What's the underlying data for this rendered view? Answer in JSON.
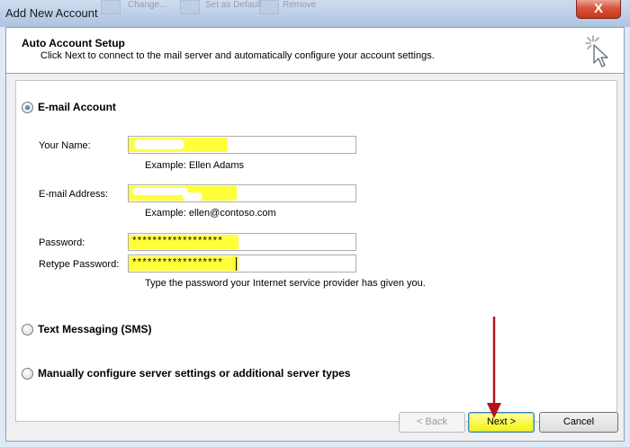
{
  "window": {
    "title": "Add New Account",
    "close_symbol": "X",
    "background_hints": [
      "Change...",
      "Set as Default",
      "Remove"
    ]
  },
  "header": {
    "title": "Auto Account Setup",
    "subtitle": "Click Next to connect to the mail server and automatically configure your account settings.",
    "icon": "cursor-click-icon"
  },
  "options": {
    "email_account": {
      "label": "E-mail Account",
      "selected": true
    },
    "text_messaging": {
      "label": "Text Messaging (SMS)",
      "selected": false
    },
    "manual_config": {
      "label": "Manually configure server settings or additional server types",
      "selected": false
    }
  },
  "form": {
    "name_label": "Your Name:",
    "name_value": "",
    "name_example": "Example: Ellen Adams",
    "email_label": "E-mail Address:",
    "email_value": "",
    "email_example": "Example: ellen@contoso.com",
    "password_label": "Password:",
    "password_value": "******************",
    "retype_label": "Retype Password:",
    "retype_value": "******************",
    "password_hint": "Type the password your Internet service provider has given you."
  },
  "buttons": {
    "back": "< Back",
    "next": "Next >",
    "cancel": "Cancel"
  },
  "colors": {
    "highlight": "#ffff3a",
    "annotation_arrow": "#b5121b",
    "title_bar": "#bccfe8"
  }
}
